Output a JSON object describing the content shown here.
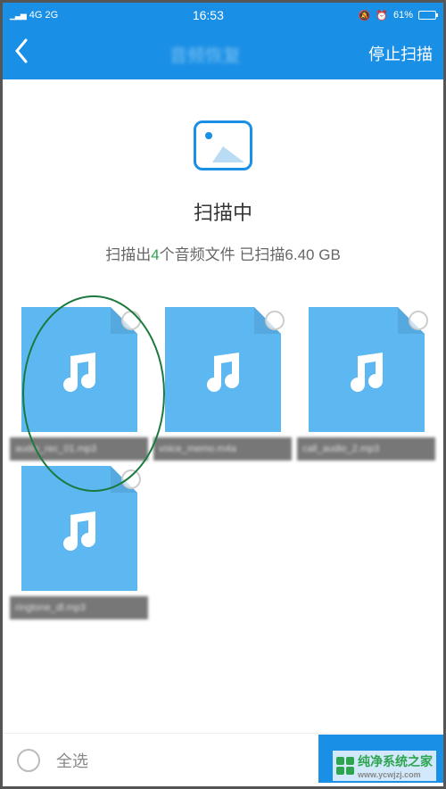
{
  "status": {
    "signal": "4G 2G",
    "time": "16:53",
    "battery_pct": "61%"
  },
  "nav": {
    "title": "音频恢复",
    "action": "停止扫描"
  },
  "scan": {
    "title": "扫描中",
    "prefix": "扫描出",
    "count": "4",
    "mid": "个音频文件 已扫描",
    "size": "6.40 GB"
  },
  "files": [
    {
      "label": "audio_rec_01.mp3"
    },
    {
      "label": "voice_memo.m4a"
    },
    {
      "label": "call_audio_2.mp3"
    },
    {
      "label": "ringtone_dl.mp3"
    }
  ],
  "bottom": {
    "select_all": "全选"
  },
  "watermark": {
    "brand": "纯净系统之家",
    "url": "www.ycwjzj.com"
  }
}
